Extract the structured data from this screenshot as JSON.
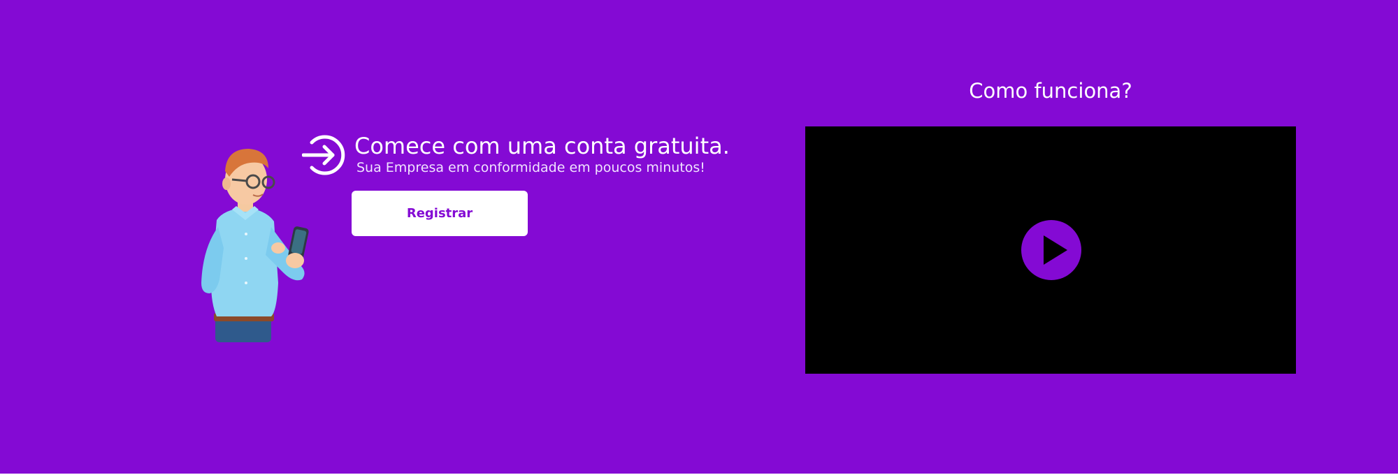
{
  "colors": {
    "brand": "#840ad4",
    "text_light": "#ffffff",
    "video_bg": "#000000"
  },
  "illustration": {
    "icon": "person-with-phone-illustration"
  },
  "signup": {
    "icon": "sign-in-arrow-icon",
    "title": "Comece com uma conta gratuita.",
    "subtitle": "Sua Empresa em conformidade em poucos minutos!",
    "button_label": "Registrar"
  },
  "video": {
    "heading": "Como funciona?",
    "icon": "play-icon"
  }
}
